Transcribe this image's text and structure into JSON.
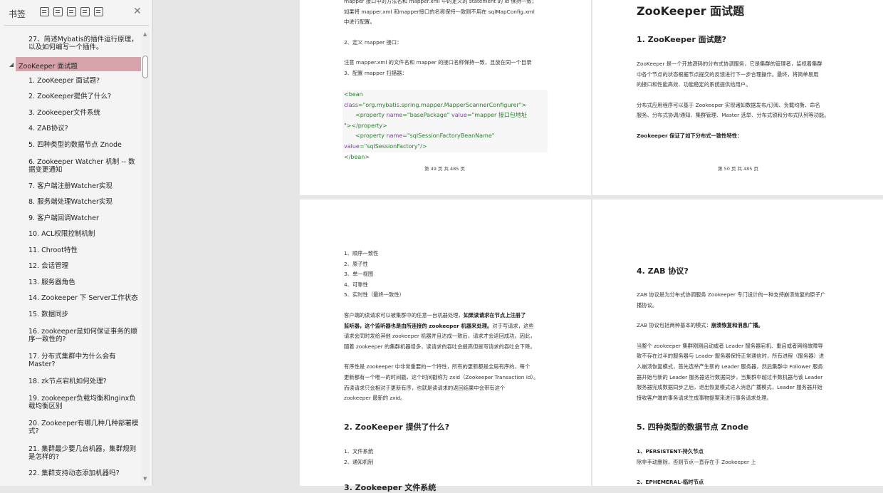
{
  "sidebar": {
    "title": "书签",
    "toc_items": [
      {
        "label": "27、简述Mybatis的插件运行原理，以及如何编写一个插件。"
      },
      {
        "label": "ZooKeeper 面试题"
      },
      {
        "label": "1. ZooKeeper 面试题?"
      },
      {
        "label": "2. ZooKeeper提供了什么?"
      },
      {
        "label": "3. Zookeeper文件系统"
      },
      {
        "label": "4. ZAB协议?"
      },
      {
        "label": "5. 四种类型的数据节点 Znode"
      },
      {
        "label": "6. Zookeeper Watcher 机制 -- 数据变更通知"
      },
      {
        "label": "7. 客户端注册Watcher实现"
      },
      {
        "label": "8. 服务端处理Watcher实现"
      },
      {
        "label": "9. 客户端回调Watcher"
      },
      {
        "label": "10. ACL权限控制机制"
      },
      {
        "label": "11. Chroot特性"
      },
      {
        "label": "12. 会话管理"
      },
      {
        "label": "13. 服务器角色"
      },
      {
        "label": "14. Zookeeper 下 Server工作状态"
      },
      {
        "label": "15. 数据同步"
      },
      {
        "label": "16. zookeeper是如何保证事务的顺序一致性的?"
      },
      {
        "label": "17. 分布式集群中为什么会有Master?"
      },
      {
        "label": "18. zk节点宕机如何处理?"
      },
      {
        "label": "19. zookeeper负载均衡和nginx负载均衡区别"
      },
      {
        "label": "20. Zookeeper有哪几种几种部署模式?"
      },
      {
        "label": "21. 集群最少要几台机器，集群规则是怎样的?"
      },
      {
        "label": "22. 集群支持动态添加机器吗?"
      }
    ]
  },
  "page49": {
    "lines": [
      "mapper 接口中的方法名和 mapper.xml 中的定义的 statement 的 id 保持一致；",
      "如果将 mapper.xml 和mapper接口的名称保持一致则不用在 sqlMapConfig.xml",
      "中进行配置。",
      "2、定义 mapper 接口：",
      "注意 mapper.xml 的文件名和 mapper 的接口名称保持一致，且放在同一个目录",
      "3、配置 mapper 扫描器："
    ],
    "code": {
      "l1_tag": "<bean ",
      "l1_attr": "class",
      "l1_val": "=\"org.mybatis.spring.mapper.MapperScannerConfigurer\">",
      "l2_tag": "<property ",
      "l2_attr": "name",
      "l2_val": "=\"basePackage\" ",
      "l2_attr2": "value",
      "l2_val2": "=\"mapper 接口包地址",
      "l3": "\"></property>",
      "l4_tag": "<property ",
      "l4_attr": "name",
      "l4_val": "=\"sqlSessionFactoryBeanName\"",
      "l5_attr": "value",
      "l5_val": "=\"sqlSessionFactory\"/>",
      "l6": "</bean>"
    },
    "page_number": "第 49 页 共 485 页"
  },
  "page50": {
    "title": "ZooKeeper 面试题",
    "h2": "1. ZooKeeper 面试题?",
    "p1": [
      "ZooKeeper 是一个开放源码的分布式协调服务，它是集群的管理者，监视着集群",
      "中各个节点的状态根据节点提交的反馈进行下一步合理操作。最终，将简单易用",
      "的接口和性能高效、功能稳定的系统提供给用户。"
    ],
    "p2": [
      "分布式应用程序可以基于 Zookeeper 实现诸如数据发布/订阅、负载均衡、命名",
      "服务、分布式协调/通知、集群管理、Master 选举、分布式锁和分布式队列等功能。"
    ],
    "p3": "Zookeeper 保证了如下分布式一致性特性：",
    "page_number": "第 50 页 共 485 页"
  },
  "page51": {
    "list": [
      "1、顺序一致性",
      "2、原子性",
      "3、单一视图",
      "4、可靠性",
      "5、实时性（最终一致性）"
    ],
    "p1": [
      {
        "plain": "客户端的读请求可以被集群中的任意一台机器处理，",
        "bold": "如果读请求在节点上注册了"
      },
      {
        "plain": "",
        "bold": "监听器，这个监听器也是由所连接的 zookeeper 机器来处理。",
        "tail": "对于写请求，这些"
      },
      {
        "plain": "请求会同时发给其他 zookeeper 机器并且达成一致后，请求才会返回成功。因此，"
      },
      {
        "plain": "随着 zookeeper 的集群机器增多，读请求的吞吐会提高但是写请求的吞吐会下降。"
      }
    ],
    "p2": [
      "有序性是 zookeeper 中非常重要的一个特性，所有的更新都是全局有序的，每个",
      "更新都有一个唯一的时间戳，这个时间戳称为 zxid（Zookeeper Transaction Id）。",
      "而读请求只会相对于更新有序，也就是读请求的返回结果中会带有这个",
      "zookeeper 最新的 zxid。"
    ],
    "h2": "2. ZooKeeper 提供了什么?",
    "list2": [
      "1、文件系统",
      "2、通知机制"
    ],
    "h2b": "3. Zookeeper 文件系统"
  },
  "page52": {
    "h2": "4. ZAB 协议?",
    "p1": [
      "ZAB 协议是为分布式协调服务 Zookeeper 专门设计的一种支持崩溃恢复的原子广",
      "播协议。"
    ],
    "p2_plain": "ZAB 协议包括两种基本的模式：",
    "p2_bold": "崩溃恢复和消息广播。",
    "p3": [
      "当整个 zookeeper 集群刚刚启动或者 Leader 服务器宕机、重启或者网络故障导",
      "致不存在过半的服务器与 Leader 服务器保持正常通信时，所有进程（服务器）进",
      "入崩溃恢复模式，首先选举产生新的 Leader 服务器，然后集群中 Follower 服务",
      "器开始与新的 Leader 服务器进行数据同步，当集群中超过半数机器与该 Leader",
      "服务器完成数据同步之后，退出恢复模式进入消息广播模式，Leader 服务器开始",
      "接收客户端的事务请求生成事物提案来进行事务请求处理。"
    ],
    "h2b": "5. 四种类型的数据节点 Znode",
    "l1": "1、PERSISTENT-持久节点",
    "l1b": "除非手动删除，否则节点一直存在于 Zookeeper 上",
    "l2": "2、EPHEMERAL-临时节点"
  }
}
